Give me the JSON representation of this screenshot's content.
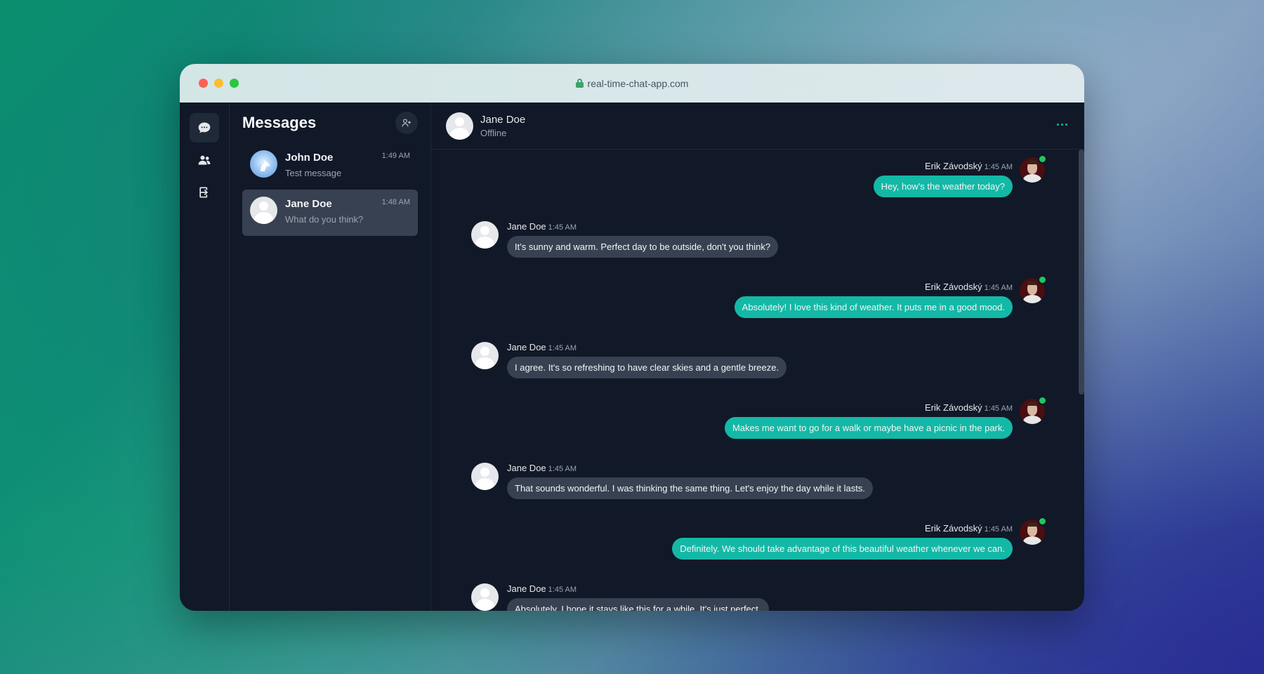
{
  "browser": {
    "url": "real-time-chat-app.com"
  },
  "rail": {
    "items": [
      {
        "icon": "chat-bubble-icon",
        "active": true
      },
      {
        "icon": "users-icon",
        "active": false
      },
      {
        "icon": "logout-icon",
        "active": false
      }
    ]
  },
  "sidebar": {
    "title": "Messages",
    "conversations": [
      {
        "name": "John Doe",
        "last_message": "Test message",
        "time": "1:49 AM",
        "active": false
      },
      {
        "name": "Jane Doe",
        "last_message": "What do you think?",
        "time": "1:48 AM",
        "active": true
      }
    ]
  },
  "chat": {
    "contact_name": "Jane Doe",
    "contact_status": "Offline",
    "messages": [
      {
        "sender": "Erik Závodský",
        "time": "1:45 AM",
        "text": "Hey, how's the weather today?",
        "outgoing": true
      },
      {
        "sender": "Jane Doe",
        "time": "1:45 AM",
        "text": "It's sunny and warm. Perfect day to be outside, don't you think?",
        "outgoing": false
      },
      {
        "sender": "Erik Závodský",
        "time": "1:45 AM",
        "text": "Absolutely! I love this kind of weather. It puts me in a good mood.",
        "outgoing": true
      },
      {
        "sender": "Jane Doe",
        "time": "1:45 AM",
        "text": "I agree. It's so refreshing to have clear skies and a gentle breeze.",
        "outgoing": false
      },
      {
        "sender": "Erik Závodský",
        "time": "1:45 AM",
        "text": "Makes me want to go for a walk or maybe have a picnic in the park.",
        "outgoing": true
      },
      {
        "sender": "Jane Doe",
        "time": "1:45 AM",
        "text": "That sounds wonderful. I was thinking the same thing. Let's enjoy the day while it lasts.",
        "outgoing": false
      },
      {
        "sender": "Erik Závodský",
        "time": "1:45 AM",
        "text": "Definitely. We should take advantage of this beautiful weather whenever we can.",
        "outgoing": true
      },
      {
        "sender": "Jane Doe",
        "time": "1:45 AM",
        "text": "Absolutely. I hope it stays like this for a while. It's just perfect.",
        "outgoing": false
      }
    ]
  },
  "colors": {
    "accent": "#14b8a6",
    "incoming_bubble": "#374151",
    "background": "#111827",
    "online": "#22c55e"
  }
}
